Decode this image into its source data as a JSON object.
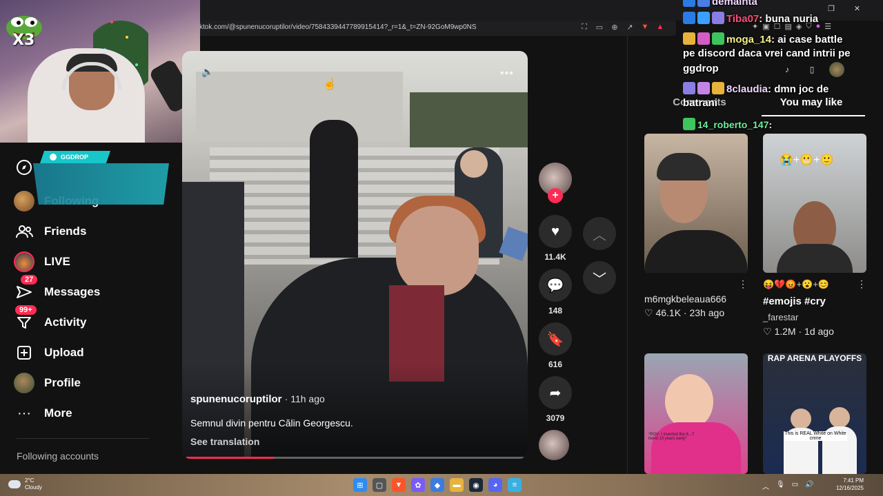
{
  "browser": {
    "url": "ktok.com/@spunenucoruptilor/video/7584339447789915414?_r=1&_t=ZN-92GoM9wp0NS"
  },
  "stream_overlay": {
    "emote_multiplier": "X3",
    "sponsor_tag": "GGDROP"
  },
  "sidebar": {
    "items": [
      {
        "label": "Following",
        "icon": "avatar"
      },
      {
        "label": "Friends",
        "icon": "friends-icon"
      },
      {
        "label": "LIVE",
        "icon": "live-icon"
      },
      {
        "label": "Messages",
        "icon": "messages-icon",
        "badge": "27"
      },
      {
        "label": "Activity",
        "icon": "activity-icon",
        "badge": "99+"
      },
      {
        "label": "Upload",
        "icon": "upload-icon"
      },
      {
        "label": "Profile",
        "icon": "profile-avatar"
      },
      {
        "label": "More",
        "icon": "more-icon"
      }
    ],
    "following_accounts_title": "Following accounts"
  },
  "video": {
    "author": "spunenucoruptilor",
    "time_ago": "· 11h ago",
    "caption": "Semnul divin pentru Călin Georgescu.",
    "see_translation": "See translation",
    "progress": 0.26
  },
  "actions": {
    "likes": "11.4K",
    "comments": "148",
    "saves": "616",
    "shares": "3079"
  },
  "right_panel": {
    "tabs": [
      "Comments",
      "You may like"
    ],
    "active_tab": 1,
    "cards": [
      {
        "title": "m6mgkbeleaua666",
        "likes": "46.1K",
        "time": "23h ago"
      },
      {
        "title": "#emojis #cry",
        "emoji_line": "😝💔😡+😮+😊",
        "author": "_farestar",
        "likes": "1.2M",
        "time": "1d ago",
        "thumb_emojis": "😭+😬+🙂"
      },
      {
        "caption": "*POV: I inverted the 6...7 trend 13 years early*"
      },
      {
        "title_overlay": "RAP ARENA PLAYOFFS",
        "caption": "This is REAL White on White crime"
      }
    ]
  },
  "chat": {
    "lines": [
      {
        "nick": "demainta",
        "text": ""
      },
      {
        "nick": "Tiba07",
        "text": "buna nuria"
      },
      {
        "nick": "moga_14",
        "text": "ai case battle pe discord daca vrei cand intrii pe ggdrop"
      },
      {
        "nick": "8claudia",
        "text": "dmn joc de batrani"
      },
      {
        "nick": "14_roberto_147",
        "text": ""
      }
    ]
  },
  "taskbar": {
    "temperature": "2°C",
    "weather": "Cloudy",
    "time": "7:41 PM",
    "date": "12/16/2025"
  }
}
